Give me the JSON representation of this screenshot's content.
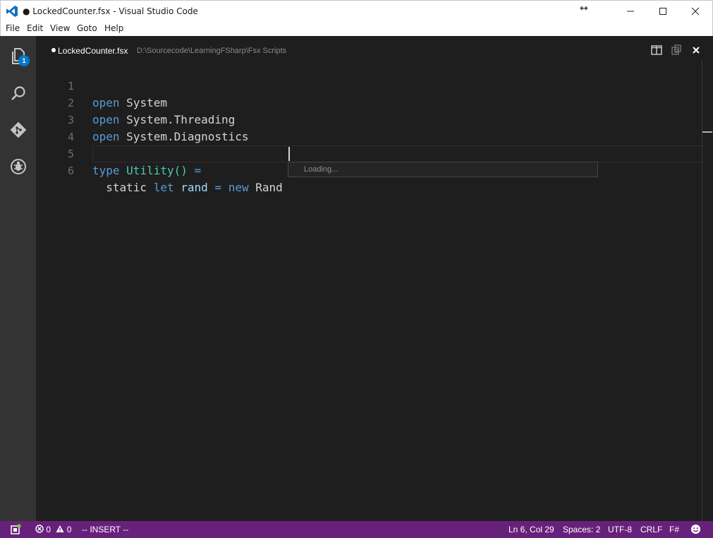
{
  "window": {
    "title": "● LockedCounter.fsx - Visual Studio Code",
    "resize_glyph": "↔"
  },
  "menu": [
    "File",
    "Edit",
    "View",
    "Goto",
    "Help"
  ],
  "activity": {
    "explorer_badge": "1",
    "icons": [
      "files-icon",
      "search-icon",
      "git-icon",
      "debug-icon"
    ]
  },
  "editor_header": {
    "file_name": "LockedCounter.fsx",
    "file_path": "D:\\Sourcecode\\LearningFSharp\\Fsx Scripts"
  },
  "code": {
    "line_numbers": [
      "1",
      "2",
      "3",
      "4",
      "5",
      "6"
    ],
    "line1": [
      "open",
      "System"
    ],
    "line2": [
      "open",
      "System.Threading"
    ],
    "line3": [
      "open",
      "System.Diagnostics"
    ],
    "line5": [
      "type",
      "Utility()",
      "="
    ],
    "line6": [
      "static",
      "let",
      "rand",
      "=",
      "new",
      "Rand"
    ]
  },
  "suggest": {
    "text": "Loading..."
  },
  "status": {
    "errors": "0",
    "warnings": "0",
    "mode": "-- INSERT --",
    "position": "Ln 6, Col 29",
    "spaces": "Spaces: 2",
    "encoding": "UTF-8",
    "eol": "CRLF",
    "language": "F#"
  },
  "colors": {
    "status_bar": "#68217a",
    "activity_bar": "#333333",
    "editor_bg": "#1e1e1e",
    "keyword": "#569cd6",
    "type": "#4ec9b0"
  }
}
